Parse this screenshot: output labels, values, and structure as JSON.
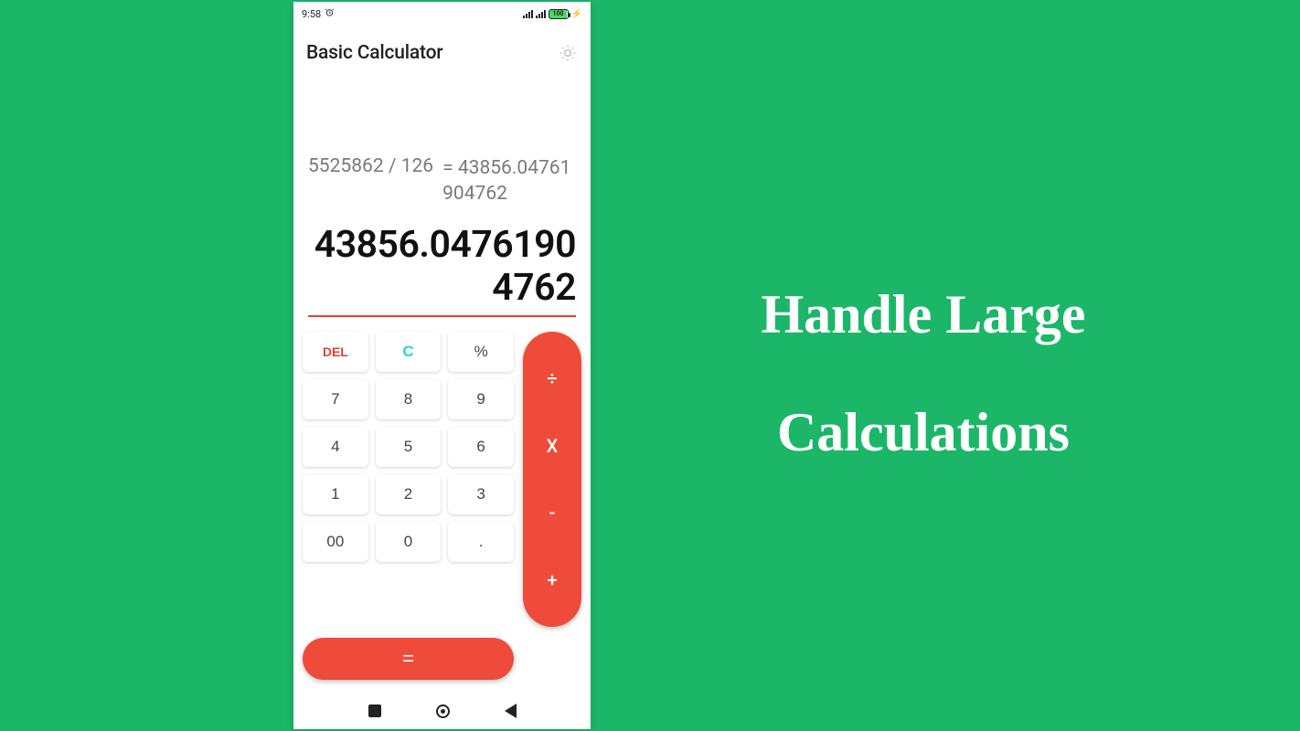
{
  "statusbar": {
    "time": "9:58",
    "battery_text": "100"
  },
  "app": {
    "title": "Basic Calculator"
  },
  "display": {
    "expression_left": "5525862  /  126",
    "expression_right": "= 43856.04761904762",
    "result": "43856.04761904762"
  },
  "keys": {
    "del": "DEL",
    "clear": "C",
    "percent": "%",
    "n7": "7",
    "n8": "8",
    "n9": "9",
    "n4": "4",
    "n5": "5",
    "n6": "6",
    "n1": "1",
    "n2": "2",
    "n3": "3",
    "n00": "00",
    "n0": "0",
    "dot": "."
  },
  "ops": {
    "divide": "÷",
    "multiply": "X",
    "minus": "-",
    "plus": "+",
    "equals": "="
  },
  "headline": "Handle Large Calculations"
}
